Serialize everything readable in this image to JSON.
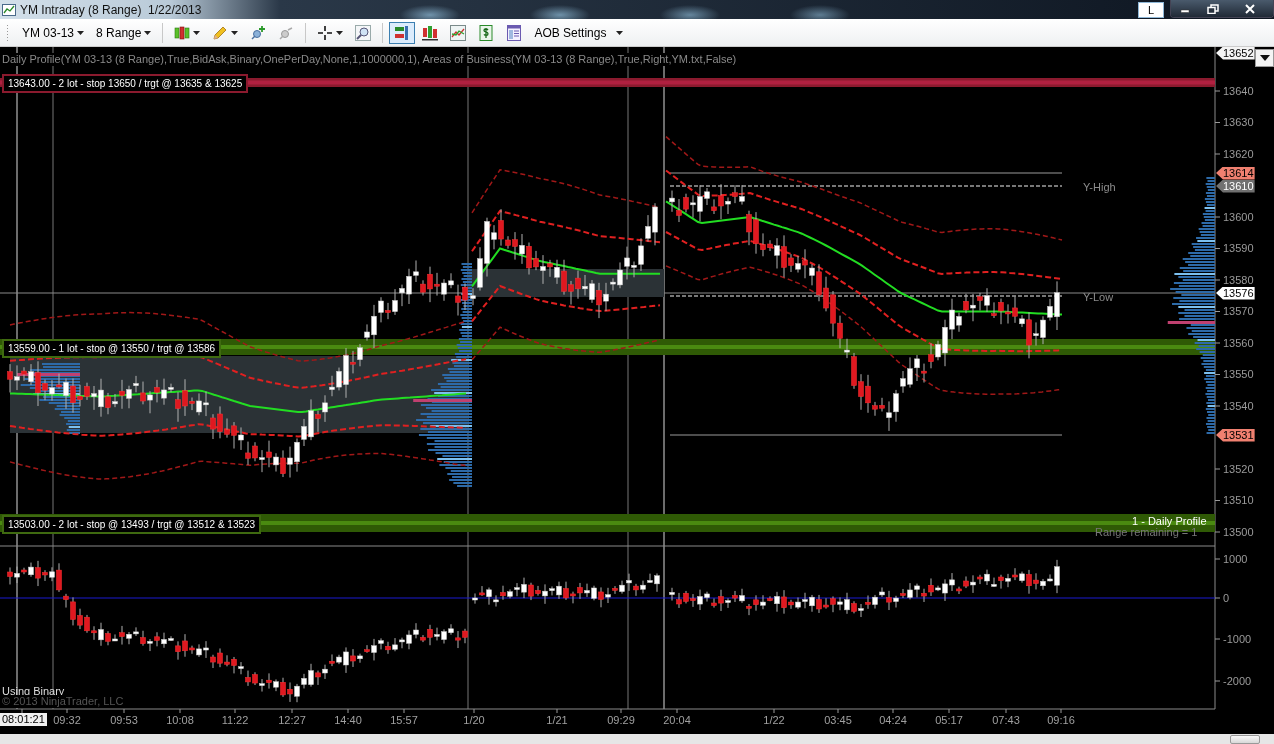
{
  "window": {
    "title": "YM Intraday (8 Range)  1/22/2013",
    "buttons": [
      "L"
    ]
  },
  "toolbar": {
    "instrument": "YM 03-13",
    "interval": "8 Range",
    "settings": "AOB Settings",
    "tools": [
      {
        "kind": "trader",
        "selected": true
      },
      {
        "kind": "candles",
        "selected": false
      },
      {
        "kind": "style",
        "selected": false
      },
      {
        "kind": "dollar",
        "selected": false
      },
      {
        "kind": "properties",
        "selected": false
      }
    ]
  },
  "chart": {
    "indicator_label": "Daily Profile(YM 03-13 (8 Range),True,BidAsk,Binary,OnePerDay,None,1,1000000,1), Areas of Business(YM 03-13 (8 Range),True,Right,YM.txt,False)",
    "zones": [
      {
        "label": "13643.00 - 2 lot - stop 13650 / trgt @ 13635 & 13625",
        "kind": "short"
      },
      {
        "label": "13559.00 - 1 lot - stop @ 13550 / trgt @ 13586",
        "kind": "long"
      },
      {
        "label": "13503.00 - 2 lot - stop @ 13493 / trgt @ 13512 & 13523",
        "kind": "long"
      }
    ],
    "levels": [
      {
        "label": "Y-High"
      },
      {
        "label": "Y-Low"
      }
    ],
    "profile_label": "1 - Daily Profile",
    "range_label": "Range remaining = 1",
    "price_ticks": [
      "13640",
      "13630",
      "13620",
      "13600",
      "13590",
      "13580",
      "13570",
      "13560",
      "13550",
      "13540",
      "13520",
      "13510",
      "13500"
    ],
    "price_markers": [
      {
        "value": "13652",
        "kind": "top"
      },
      {
        "value": "13614",
        "kind": "extreme"
      },
      {
        "value": "13610",
        "kind": "last"
      },
      {
        "value": "13576",
        "kind": "cursor"
      },
      {
        "value": "13531",
        "kind": "extreme"
      }
    ],
    "lower_ticks": [
      "1000",
      "0",
      "-1000",
      "-2000"
    ],
    "indicator_name": "Using Binary",
    "copyright": "© 2013 NinjaTrader, LLC",
    "time_labels": [
      {
        "label": "08:01:21",
        "kind": "cursor"
      },
      {
        "label": "09:32",
        "kind": "tick"
      },
      {
        "label": "09:53",
        "kind": "tick"
      },
      {
        "label": "10:08",
        "kind": "tick"
      },
      {
        "label": "11:22",
        "kind": "tick"
      },
      {
        "label": "12:27",
        "kind": "tick"
      },
      {
        "label": "14:40",
        "kind": "tick"
      },
      {
        "label": "15:57",
        "kind": "tick"
      },
      {
        "label": "1/20",
        "kind": "tick"
      },
      {
        "label": "1/21",
        "kind": "tick"
      },
      {
        "label": "09:29",
        "kind": "tick"
      },
      {
        "label": "20:04",
        "kind": "tick"
      },
      {
        "label": "1/22",
        "kind": "tick"
      },
      {
        "label": "03:45",
        "kind": "tick"
      },
      {
        "label": "04:24",
        "kind": "tick"
      },
      {
        "label": "05:17",
        "kind": "tick"
      },
      {
        "label": "07:43",
        "kind": "tick"
      },
      {
        "label": "09:16",
        "kind": "tick"
      }
    ]
  }
}
